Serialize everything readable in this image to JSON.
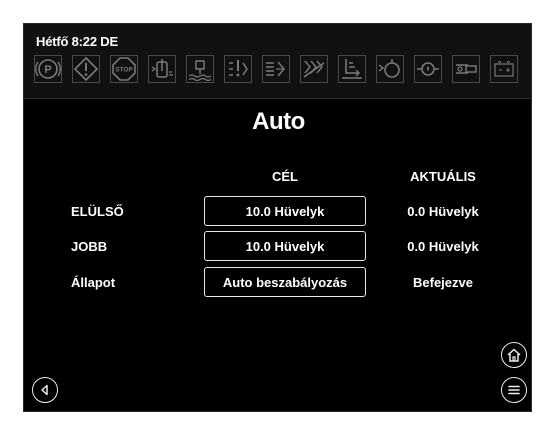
{
  "status": {
    "clock": "Hétfő 8:22 DE",
    "indicators": [
      {
        "icon": "parking-brake-icon",
        "glyph": "(P)"
      },
      {
        "icon": "warning-icon"
      },
      {
        "icon": "stop-icon",
        "glyph": "STOP"
      },
      {
        "icon": "coolant-temperature-icon"
      },
      {
        "icon": "water-in-fuel-icon"
      },
      {
        "icon": "hydraulic-icon-1"
      },
      {
        "icon": "hydraulic-icon-2"
      },
      {
        "icon": "hydraulic-filter-icon"
      },
      {
        "icon": "exhaust-icon"
      },
      {
        "icon": "engine-oil-pressure-icon"
      },
      {
        "icon": "oil-level-icon"
      },
      {
        "icon": "transmission-icon"
      },
      {
        "icon": "battery-icon"
      }
    ]
  },
  "screen": {
    "title": "Auto"
  },
  "table": {
    "headers": {
      "target": "CÉL",
      "actual": "AKTUÁLIS"
    },
    "rows": [
      {
        "label": "ELÜLSŐ",
        "target": "10.0 Hüvelyk",
        "actual": "0.0 Hüvelyk"
      },
      {
        "label": "JOBB",
        "target": "10.0 Hüvelyk",
        "actual": "0.0 Hüvelyk"
      },
      {
        "label": "Állapot",
        "target": "Auto beszabályozás",
        "actual": "Befejezve"
      }
    ]
  },
  "nav": {
    "back": "back-icon",
    "home": "home-icon",
    "menu": "menu-icon"
  },
  "colors": {
    "background": "#000000",
    "text": "#ffffff",
    "indicator": "#6a6a6a"
  }
}
